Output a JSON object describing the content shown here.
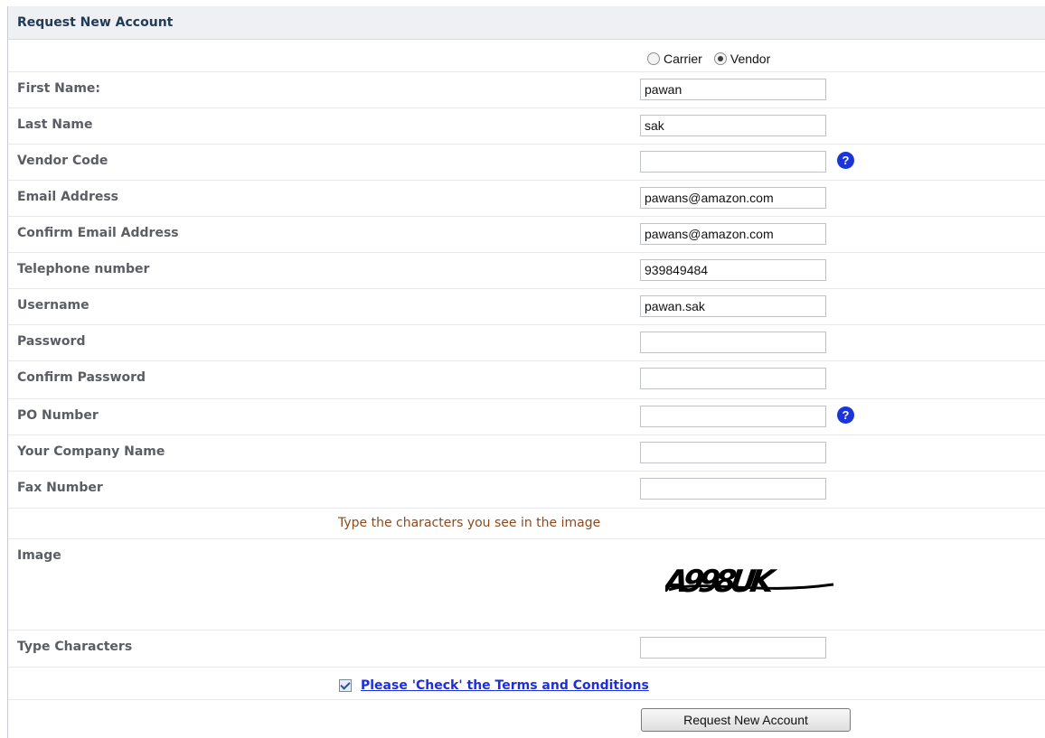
{
  "form": {
    "title": "Request New Account",
    "account_type": {
      "options": [
        "Carrier",
        "Vendor"
      ],
      "selected": "Vendor"
    },
    "fields": {
      "first_name": {
        "label": "First Name:",
        "value": "pawan"
      },
      "last_name": {
        "label": "Last Name",
        "value": "sak"
      },
      "vendor_code": {
        "label": "Vendor Code",
        "value": ""
      },
      "email": {
        "label": "Email Address",
        "value": "pawans@amazon.com"
      },
      "confirm_email": {
        "label": "Confirm Email Address",
        "value": "pawans@amazon.com"
      },
      "telephone": {
        "label": "Telephone number",
        "value": "939849484"
      },
      "username": {
        "label": "Username",
        "value": "pawan.sak"
      },
      "password": {
        "label": "Password",
        "value": ""
      },
      "confirm_password": {
        "label": "Confirm Password",
        "value": ""
      },
      "po_number": {
        "label": "PO Number",
        "value": ""
      },
      "company_name": {
        "label": "Your Company Name",
        "value": ""
      },
      "fax_number": {
        "label": "Fax Number",
        "value": ""
      },
      "type_characters": {
        "label": "Type Characters",
        "value": ""
      }
    },
    "help_icon_glyph": "?",
    "captcha": {
      "instruction": "Type the characters you see in the image",
      "label": "Image",
      "text": "A998UK"
    },
    "terms": {
      "checked": true,
      "link_text": "Please 'Check' the Terms and Conditions"
    },
    "submit_label": "Request New Account"
  },
  "colors": {
    "header_bg": "#eef0f4",
    "label_text": "#5a5e63",
    "help_icon": "#1a35d8",
    "captcha_instruction": "#8b4a1e",
    "link": "#1f2fd8"
  }
}
